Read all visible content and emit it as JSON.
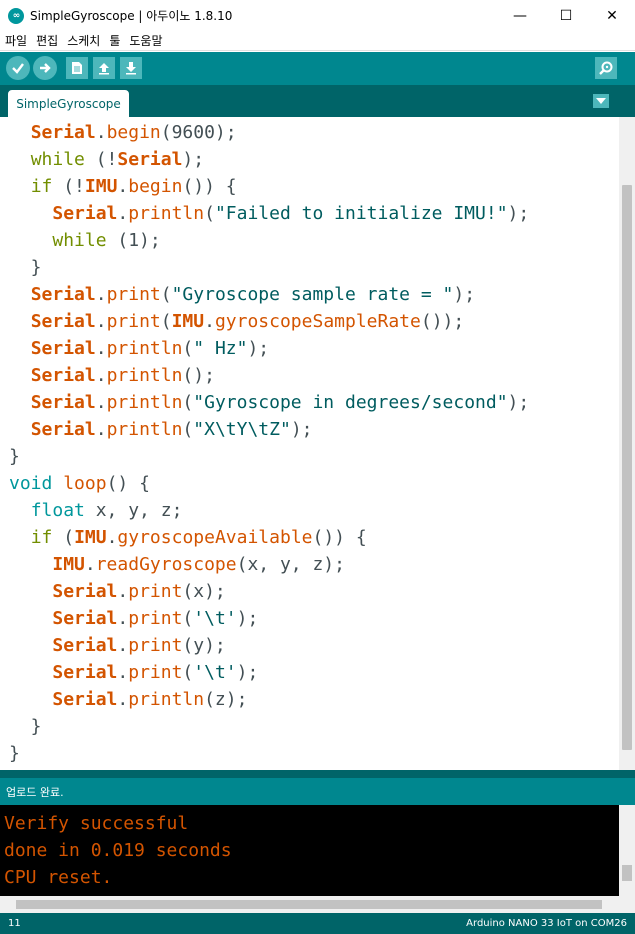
{
  "window": {
    "title": "SimpleGyroscope | 아두이노 1.8.10",
    "minimize": "—",
    "maximize": "☐",
    "close": "✕"
  },
  "menu": [
    "파일",
    "편집",
    "스케치",
    "툴",
    "도움말"
  ],
  "toolbar": {
    "verify_icon": "check-icon",
    "upload_icon": "arrow-right-icon",
    "new_icon": "new-file-icon",
    "open_icon": "upload-arrow-icon",
    "save_icon": "download-arrow-icon",
    "monitor_icon": "magnifier-icon"
  },
  "tab": {
    "label": "SimpleGyroscope",
    "menu_icon": "triangle-down-icon"
  },
  "code": [
    "  Serial.begin(9600);",
    "  while (!Serial);",
    "  if (!IMU.begin()) {",
    "    Serial.println(\"Failed to initialize IMU!\");",
    "    while (1);",
    "  }",
    "  Serial.print(\"Gyroscope sample rate = \");",
    "  Serial.print(IMU.gyroscopeSampleRate());",
    "  Serial.println(\" Hz\");",
    "  Serial.println();",
    "  Serial.println(\"Gyroscope in degrees/second\");",
    "  Serial.println(\"X\\tY\\tZ\");",
    "}",
    "void loop() {",
    "  float x, y, z;",
    "  if (IMU.gyroscopeAvailable()) {",
    "    IMU.readGyroscope(x, y, z);",
    "    Serial.print(x);",
    "    Serial.print('\\t');",
    "    Serial.print(y);",
    "    Serial.print('\\t');",
    "    Serial.println(z);",
    "  }",
    "}"
  ],
  "status": {
    "message": "업로드 완료."
  },
  "console": [
    "Verify successful",
    "done in 0.019 seconds",
    "CPU reset."
  ],
  "footer": {
    "line": "11",
    "board": "Arduino NANO 33 IoT on COM26"
  },
  "colors": {
    "toolbar": "#00878f",
    "tabbar": "#006468",
    "keyword": "#d35400",
    "type": "#00979c",
    "control": "#728e00",
    "console_text": "#d35400"
  }
}
